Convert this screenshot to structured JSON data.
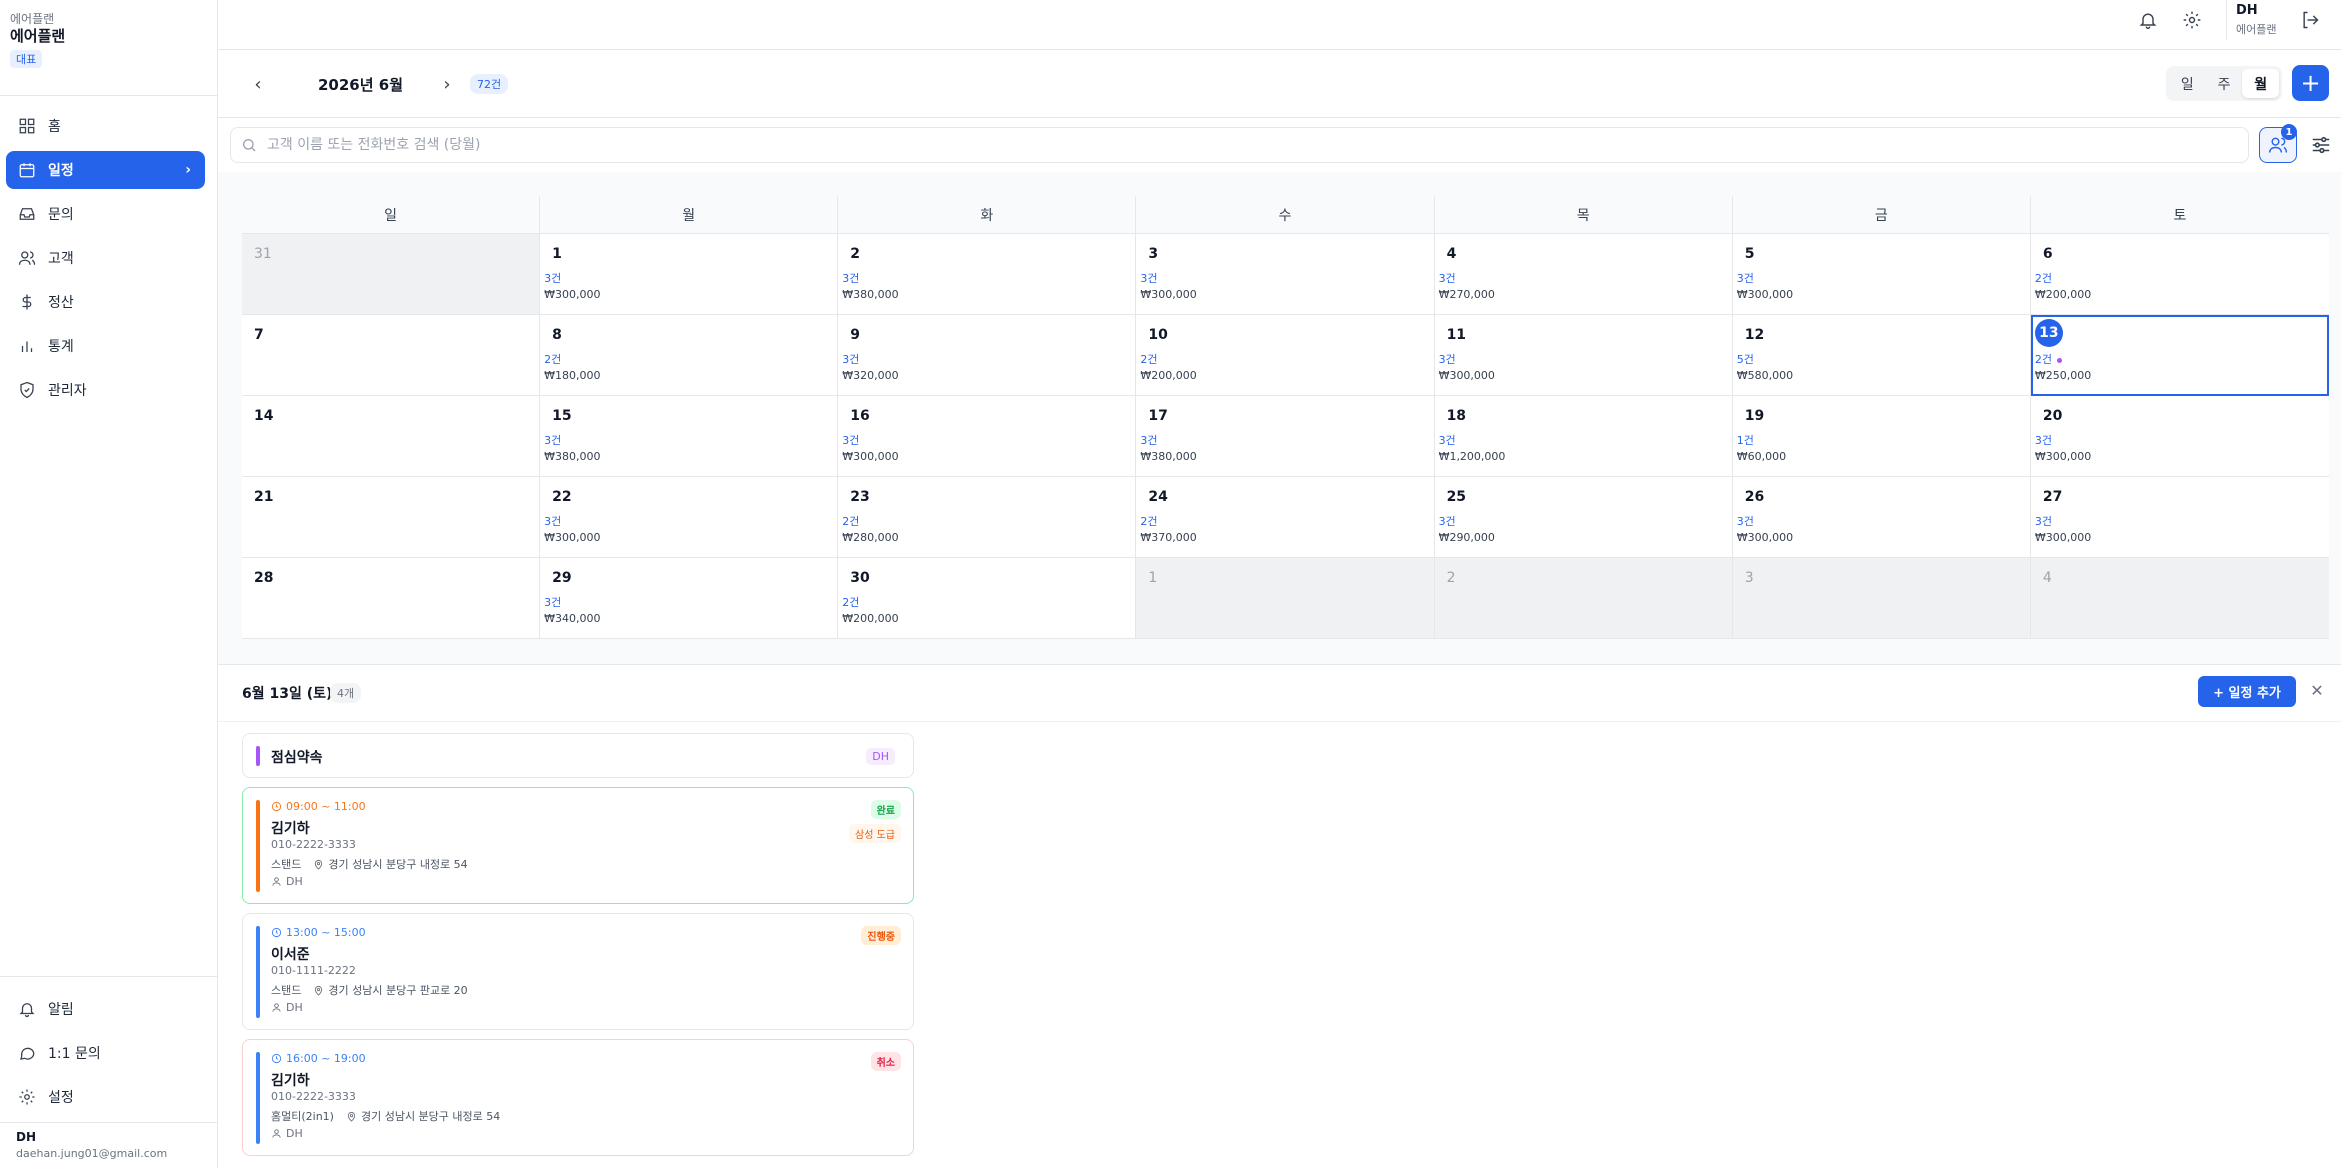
{
  "brand": {
    "small": "에어플랜",
    "name": "에어플랜",
    "badge": "대표"
  },
  "nav": [
    {
      "label": "홈",
      "icon": "grid-icon"
    },
    {
      "label": "일정",
      "icon": "calendar-icon",
      "active": true
    },
    {
      "label": "문의",
      "icon": "inbox-icon"
    },
    {
      "label": "고객",
      "icon": "users-icon"
    },
    {
      "label": "정산",
      "icon": "dollar-icon"
    },
    {
      "label": "통계",
      "icon": "bar-chart-icon"
    },
    {
      "label": "관리자",
      "icon": "shield-icon"
    }
  ],
  "nav_bottom": [
    {
      "label": "알림",
      "icon": "bell-icon"
    },
    {
      "label": "1:1 문의",
      "icon": "message-icon"
    },
    {
      "label": "설정",
      "icon": "gear-icon"
    }
  ],
  "user": {
    "name": "DH",
    "email": "daehan.jung01@gmail.com"
  },
  "topbar": {
    "user_name": "DH",
    "user_org": "에어플랜"
  },
  "month": {
    "title": "2026년 6월",
    "count": "72건"
  },
  "view_modes": [
    "일",
    "주",
    "월"
  ],
  "view_selected": "월",
  "search": {
    "placeholder": "고객 이름 또는 전화번호 검색 (당월)"
  },
  "staff_filter_count": "1",
  "weekdays": [
    "일",
    "월",
    "화",
    "수",
    "목",
    "금",
    "토"
  ],
  "calendar": [
    {
      "day": "31",
      "other": true
    },
    {
      "day": "1",
      "count": "3건",
      "amount": "₩300,000"
    },
    {
      "day": "2",
      "count": "3건",
      "amount": "₩380,000"
    },
    {
      "day": "3",
      "count": "3건",
      "amount": "₩300,000"
    },
    {
      "day": "4",
      "count": "3건",
      "amount": "₩270,000"
    },
    {
      "day": "5",
      "count": "3건",
      "amount": "₩300,000"
    },
    {
      "day": "6",
      "count": "2건",
      "amount": "₩200,000"
    },
    {
      "day": "7"
    },
    {
      "day": "8",
      "count": "2건",
      "amount": "₩180,000"
    },
    {
      "day": "9",
      "count": "3건",
      "amount": "₩320,000"
    },
    {
      "day": "10",
      "count": "2건",
      "amount": "₩200,000"
    },
    {
      "day": "11",
      "count": "3건",
      "amount": "₩300,000"
    },
    {
      "day": "12",
      "count": "5건",
      "amount": "₩580,000"
    },
    {
      "day": "13",
      "count": "2건",
      "amount": "₩250,000",
      "selected": true
    },
    {
      "day": "14"
    },
    {
      "day": "15",
      "count": "3건",
      "amount": "₩380,000"
    },
    {
      "day": "16",
      "count": "3건",
      "amount": "₩300,000"
    },
    {
      "day": "17",
      "count": "3건",
      "amount": "₩380,000"
    },
    {
      "day": "18",
      "count": "3건",
      "amount": "₩1,200,000"
    },
    {
      "day": "19",
      "count": "1건",
      "amount": "₩60,000"
    },
    {
      "day": "20",
      "count": "3건",
      "amount": "₩300,000"
    },
    {
      "day": "21"
    },
    {
      "day": "22",
      "count": "3건",
      "amount": "₩300,000"
    },
    {
      "day": "23",
      "count": "2건",
      "amount": "₩280,000"
    },
    {
      "day": "24",
      "count": "2건",
      "amount": "₩370,000"
    },
    {
      "day": "25",
      "count": "3건",
      "amount": "₩290,000"
    },
    {
      "day": "26",
      "count": "3건",
      "amount": "₩300,000"
    },
    {
      "day": "27",
      "count": "3건",
      "amount": "₩300,000"
    },
    {
      "day": "28"
    },
    {
      "day": "29",
      "count": "3건",
      "amount": "₩340,000"
    },
    {
      "day": "30",
      "count": "2건",
      "amount": "₩200,000"
    },
    {
      "day": "1",
      "other": true
    },
    {
      "day": "2",
      "other": true
    },
    {
      "day": "3",
      "other": true
    },
    {
      "day": "4",
      "other": true
    }
  ],
  "detail": {
    "title": "6월 13일 (토)",
    "count": "4개",
    "add_label": "+ 일정 추가",
    "close": "✕"
  },
  "events": [
    {
      "kind": "memo",
      "title": "점심약속",
      "tag": "DH",
      "bar_color": "#a855f7"
    },
    {
      "time": "09:00 ~ 11:00",
      "name": "김기하",
      "phone": "010-2222-3333",
      "service": "스탠드",
      "address": "경기 성남시 분당구 내정로 54",
      "staff": "DH",
      "status": "완료",
      "extra": "삼성 도급",
      "bar_color": "#f97316",
      "time_color": "#f97316",
      "border_color": "#86efac"
    },
    {
      "time": "13:00 ~ 15:00",
      "name": "이서준",
      "phone": "010-1111-2222",
      "service": "스탠드",
      "address": "경기 성남시 분당구 판교로 20",
      "staff": "DH",
      "status": "진행중",
      "bar_color": "#3b82f6",
      "time_color": "#3b82f6",
      "border_color": "#e5e7eb"
    },
    {
      "time": "16:00 ~ 19:00",
      "name": "김기하",
      "phone": "010-2222-3333",
      "service": "홈멀티(2in1)",
      "address": "경기 성남시 분당구 내정로 54",
      "staff": "DH",
      "status": "취소",
      "bar_color": "#3b82f6",
      "time_color": "#3b82f6",
      "border_color": "#fecdd3"
    }
  ],
  "colors": {
    "accent": "#2563eb",
    "done": "#16a34a",
    "progress": "#ea580c",
    "cancel": "#e11d48"
  }
}
